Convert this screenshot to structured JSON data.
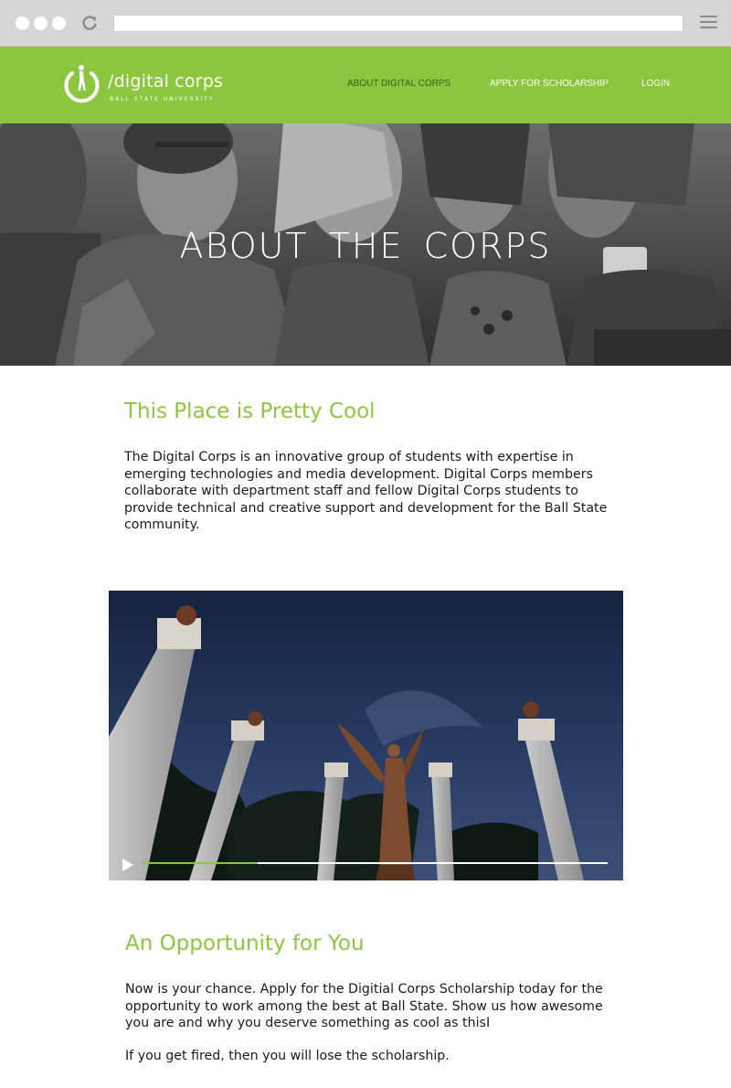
{
  "browser": {
    "window_controls": [
      "dot",
      "dot",
      "dot"
    ],
    "reload_icon": "reload-icon",
    "url": "",
    "menu_icon": "hamburger-icon"
  },
  "nav": {
    "logo_text": "/digital corps",
    "logo_subtext": "BALL STATE UNIVERSITY",
    "links": [
      {
        "label": "ABOUT DIGITAL CORPS",
        "active": true
      },
      {
        "label": "APPLY FOR SCHOLARSHIP",
        "active": false
      },
      {
        "label": "LOGIN",
        "active": false
      }
    ],
    "background_color": "#8cc63f"
  },
  "hero": {
    "title": "ABOUT THE CORPS"
  },
  "section1": {
    "heading": "This Place is Pretty Cool",
    "lines": [
      "The Digital Corps is an innovative group of students with expertise in",
      "emerging technologies and media development. Digital Corps members",
      "collaborate with department staff and fellow Digital Corps students to",
      "provide technical and creative support and development for the Ball State",
      "community."
    ]
  },
  "video": {
    "play_icon": "play-icon",
    "progress": 0.25
  },
  "section2": {
    "heading": "An Opportunity for You",
    "lines": [
      "Now is your chance. Apply for the Digitial Corps Scholarship today for the",
      "opportunity to work among the best at Ball State. Show us how awesome",
      "you are and why you deserve something as cool as thisI"
    ],
    "note": "If you get fired, then you will lose the scholarship."
  },
  "accent_color": "#8cc63f"
}
